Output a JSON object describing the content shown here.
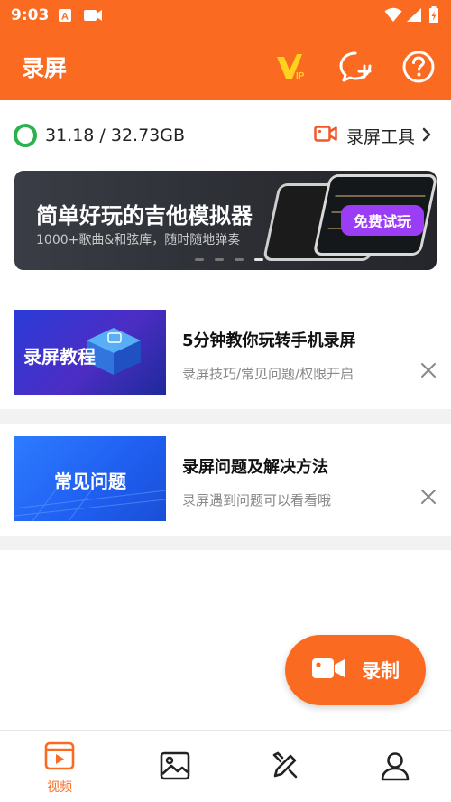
{
  "status_bar": {
    "time": "9:03"
  },
  "app_bar": {
    "title": "录屏"
  },
  "storage": {
    "text": "31.18 / 32.73GB",
    "used_fraction": 0.953
  },
  "tools": {
    "label": "录屏工具"
  },
  "banner": {
    "title": "简单好玩的吉他模拟器",
    "subtitle": "1000+歌曲&和弦库，随时随地弹奏",
    "cta": "免费试玩",
    "page_count": 4,
    "active_page": 4
  },
  "cards": [
    {
      "thumb_text": "录屏教程",
      "title": "5分钟教你玩转手机录屏",
      "subtitle": "录屏技巧/常见问题/权限开启"
    },
    {
      "thumb_text": "常见问题",
      "title": "录屏问题及解决方法",
      "subtitle": "录屏遇到问题可以看看哦"
    }
  ],
  "fab": {
    "label": "录制"
  },
  "bottom_nav": {
    "video_label": "视频"
  },
  "colors": {
    "accent": "#fb6a21",
    "storage_ring": "#2bb24c",
    "cta_purple": "#9b3df5"
  }
}
